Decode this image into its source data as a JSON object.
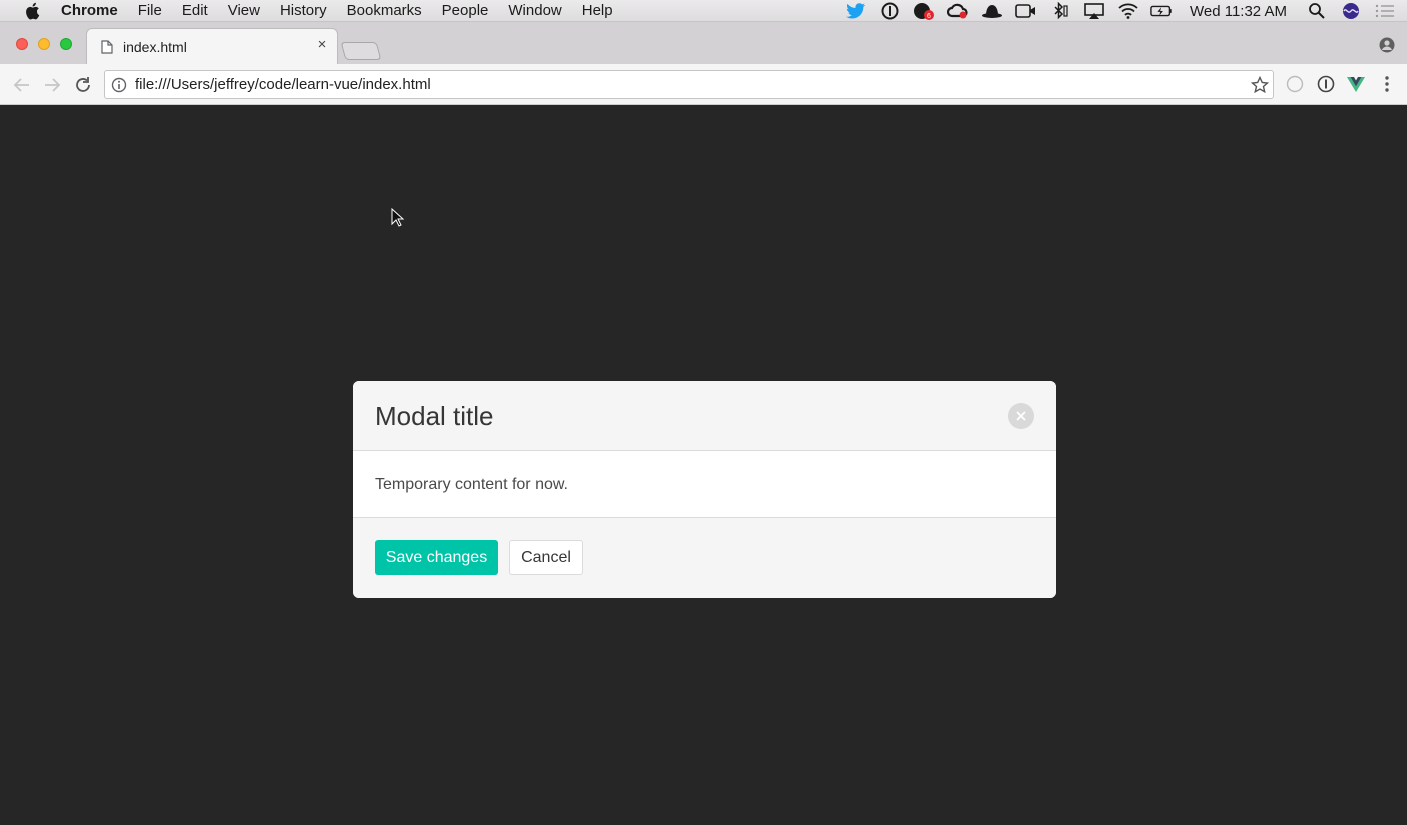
{
  "menubar": {
    "app_name": "Chrome",
    "items": [
      "File",
      "Edit",
      "View",
      "History",
      "Bookmarks",
      "People",
      "Window",
      "Help"
    ],
    "clock": "Wed 11:32 AM",
    "status_icons": [
      "twitter-icon",
      "onepassword-icon",
      "notification-badge-icon",
      "creative-cloud-icon",
      "alfred-hat-icon",
      "facetime-icon",
      "bluetooth-icon",
      "airplay-icon",
      "wifi-icon",
      "battery-charging-icon",
      "spotlight-search-icon",
      "siri-icon",
      "notification-center-icon"
    ],
    "badge_count": "6"
  },
  "browser": {
    "tab_title": "index.html",
    "url": "file:///Users/jeffrey/code/learn-vue/index.html"
  },
  "modal": {
    "title": "Modal title",
    "body_text": "Temporary content for now.",
    "save_label": "Save changes",
    "cancel_label": "Cancel"
  },
  "colors": {
    "page_background": "#262626",
    "primary_button": "#00c4a7",
    "modal_header": "#f5f5f5"
  }
}
